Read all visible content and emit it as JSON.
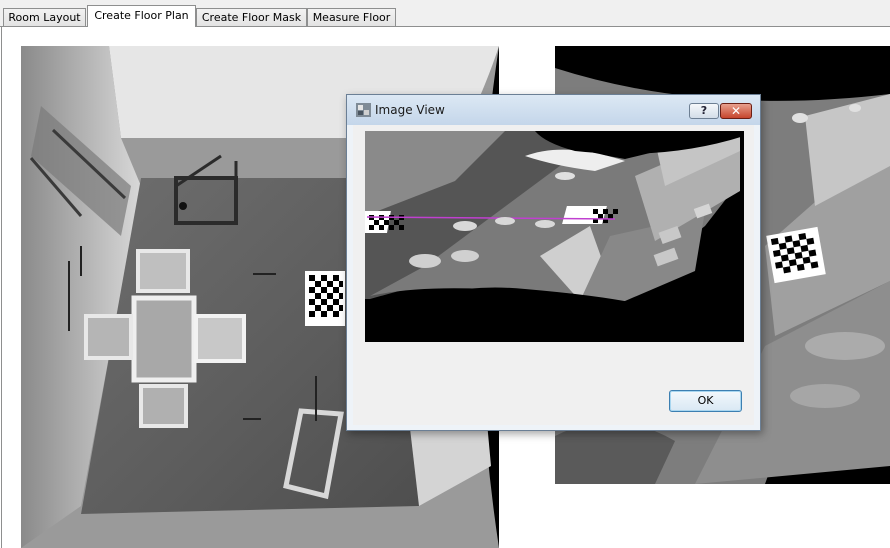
{
  "tabs": [
    {
      "label": "Room Layout",
      "active": false
    },
    {
      "label": "Create Floor Plan",
      "active": true
    },
    {
      "label": "Create Floor Mask",
      "active": false
    },
    {
      "label": "Measure Floor",
      "active": false
    }
  ],
  "dialog": {
    "title": "Image View",
    "help_label": "?",
    "close_label": "✕",
    "ok_label": "OK"
  },
  "colors": {
    "accent_line": "#c040d0",
    "window_chrome": "#c4d6ea",
    "close_button": "#c6452d"
  }
}
